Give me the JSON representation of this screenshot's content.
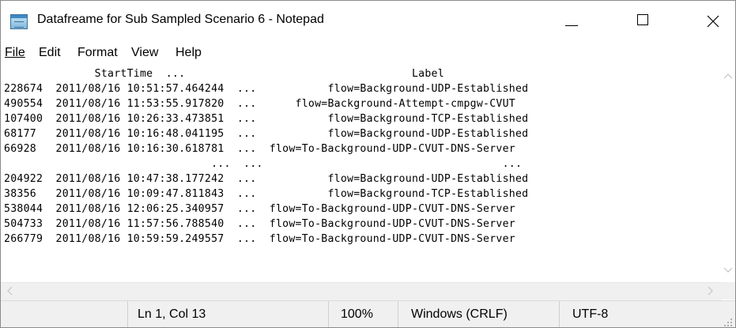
{
  "window": {
    "title": "Datafreame for Sub Sampled Scenario 6 - Notepad"
  },
  "menu": {
    "file": "File",
    "edit": "Edit",
    "format": "Format",
    "view": "View",
    "help": "Help"
  },
  "editor": {
    "lines": [
      "              StartTime  ...                                   Label",
      "228674  2011/08/16 10:51:57.464244  ...           flow=Background-UDP-Established",
      "490554  2011/08/16 11:53:55.917820  ...      flow=Background-Attempt-cmpgw-CVUT",
      "107400  2011/08/16 10:26:33.473851  ...           flow=Background-TCP-Established",
      "68177   2011/08/16 10:16:48.041195  ...           flow=Background-UDP-Established",
      "66928   2011/08/16 10:16:30.618781  ...  flow=To-Background-UDP-CVUT-DNS-Server",
      "                                ...  ...                                     ...",
      "204922  2011/08/16 10:47:38.177242  ...           flow=Background-UDP-Established",
      "38356   2011/08/16 10:09:47.811843  ...           flow=Background-TCP-Established",
      "538044  2011/08/16 12:06:25.340957  ...  flow=To-Background-UDP-CVUT-DNS-Server",
      "504733  2011/08/16 11:57:56.788540  ...  flow=To-Background-UDP-CVUT-DNS-Server",
      "266779  2011/08/16 10:59:59.249557  ...  flow=To-Background-UDP-CVUT-DNS-Server"
    ]
  },
  "status": {
    "position": "Ln 1, Col 13",
    "zoom": "100%",
    "line_ending": "Windows (CRLF)",
    "encoding": "UTF-8"
  },
  "icons": {
    "app": "notepad-icon",
    "minimize": "minimize-icon",
    "maximize": "maximize-icon",
    "close": "close-icon",
    "scroll_up": "chevron-up-icon",
    "scroll_down": "chevron-down-icon",
    "scroll_left": "chevron-left-icon",
    "scroll_right": "chevron-right-icon",
    "grip": "resize-grip-icon"
  }
}
